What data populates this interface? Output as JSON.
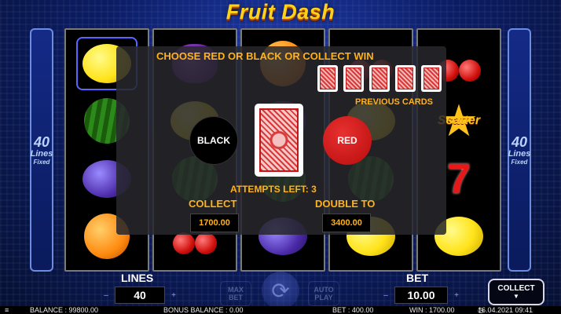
{
  "game": {
    "title": "Fruit Dash"
  },
  "side_panel": {
    "number": "40",
    "text": "Lines",
    "sub": "Fixed"
  },
  "reels": [
    [
      "lemon",
      "melon",
      "plum",
      "orange"
    ],
    [
      "grape",
      "lemon",
      "melon",
      "cherry"
    ],
    [
      "orange",
      "grape",
      "melon",
      "plum"
    ],
    [
      "cherry",
      "lemon",
      "melon",
      "lemon"
    ],
    [
      "cherry",
      "star",
      "seven",
      "lemon"
    ]
  ],
  "scatter_label": "Scatter",
  "gamble": {
    "title": "CHOOSE RED OR BLACK OR COLLECT WIN",
    "previous_cards_label": "PREVIOUS CARDS",
    "previous_cards_count": 5,
    "black_label": "BLACK",
    "red_label": "RED",
    "attempts_left": "ATTEMPTS LEFT: 3",
    "collect_label": "COLLECT",
    "collect_value": "1700.00",
    "double_label": "DOUBLE TO",
    "double_value": "3400.00"
  },
  "controls": {
    "lines_label": "LINES",
    "lines_value": "40",
    "bet_label": "BET",
    "bet_value": "10.00",
    "minus": "–",
    "plus": "+",
    "max_bet": "MAX BET",
    "auto_play": "AUTO PLAY",
    "spin_icon": "spin-refresh-icon",
    "collect_button": "COLLECT",
    "collect_caret": "▼"
  },
  "status": {
    "menu_icon": "hamburger-menu-icon",
    "balance": "BALANCE : 99800.00",
    "bonus_balance": "BONUS BALANCE : 0.00",
    "bet": "BET : 400.00",
    "win": "WIN : 1700.00",
    "datetime": "16.04.2021 09:41"
  },
  "colors": {
    "accent_orange": "#ffb21a",
    "logo_yellow": "#ffd21a",
    "red_button": "#e83030",
    "black_button": "#000000"
  }
}
